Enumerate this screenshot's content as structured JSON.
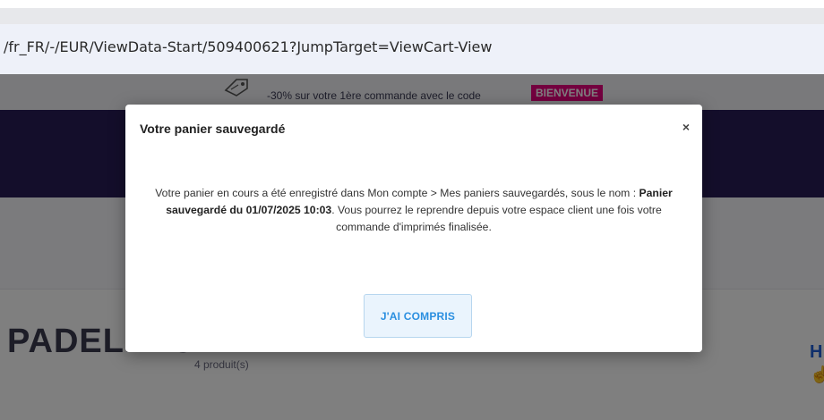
{
  "browser": {
    "url": "/fr_FR/-/EUR/ViewData-Start/509400621?JumpTarget=ViewCart-View"
  },
  "promo": {
    "text": "-30% sur votre 1ère commande avec le code",
    "code": "BIENVENUE",
    "icon": "tag-icon",
    "code_color": "#e6007e"
  },
  "navbar": {
    "color": "#291c57"
  },
  "cart": {
    "title": "PADELLEC",
    "count": "4 produit(s)"
  },
  "modal": {
    "title": "Votre panier sauvegardé",
    "close_label": "×",
    "body_prefix": "Votre panier en cours a été enregistré dans Mon compte > Mes paniers sauvegardés, sous le nom : ",
    "body_name": "Panier sauvegardé du 01/07/2025 10:03",
    "body_suffix": ". Vous pourrez le reprendre depuis votre espace client une fois votre commande d'imprimés finalisée.",
    "button_label": "J'AI COMPRIS"
  }
}
